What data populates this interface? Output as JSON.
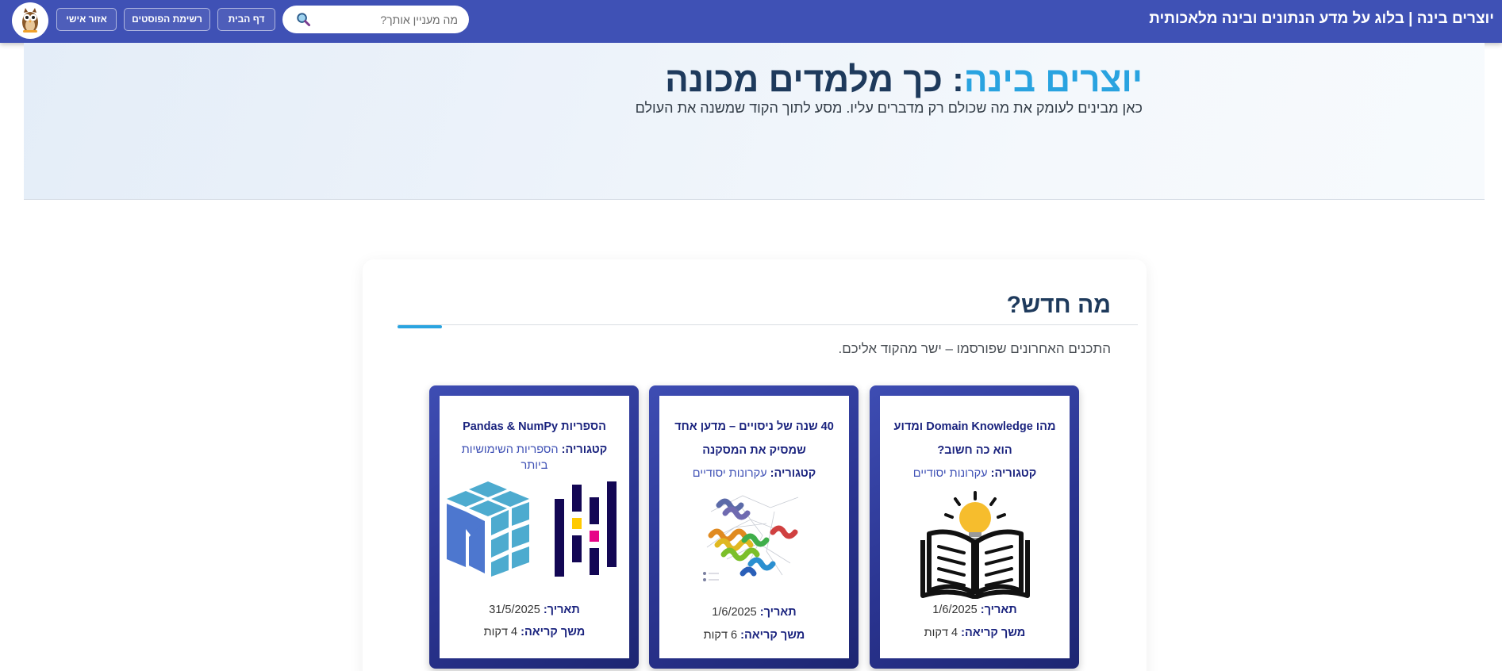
{
  "nav": {
    "site_title": "יוצרים בינה | בלוג על מדע הנתונים ובינה מלאכותית",
    "search_placeholder": "מה מעניין אותך?",
    "buttons": {
      "home": "דף הבית",
      "posts": "רשימת הפוסטים",
      "personal": "אזור אישי"
    },
    "avatar_icon": "owl-avatar-icon"
  },
  "hero": {
    "title_accent": "יוצרים בינה",
    "title_rest": ": כך מלמדים מכונה",
    "subtitle": "כאן מבינים לעומק את מה שכולם רק מדברים עליו. מסע לתוך הקוד שמשנה את העולם"
  },
  "section": {
    "title": "מה חדש?",
    "description": "התכנים האחרונים שפורסמו – ישר מהקוד אליכם."
  },
  "labels": {
    "category": "קטגוריה:",
    "date": "תאריך:",
    "read_time": "משך קריאה:"
  },
  "posts": [
    {
      "title": "מהו Domain Knowledge ומדוע הוא כה חשוב?",
      "category": "עקרונות יסודיים",
      "date": "1/6/2025",
      "read_time": "4 דקות",
      "image": "book-lightbulb-icon"
    },
    {
      "title": "40 שנה של ניסויים – מדען אחד שמסיק את המסקנה",
      "category": "עקרונות יסודיים",
      "date": "1/6/2025",
      "read_time": "6 דקות",
      "image": "protein-structure-image"
    },
    {
      "title": "הספריות Pandas & NumPy",
      "category": "הספריות השימושיות ביותר",
      "date": "31/5/2025",
      "read_time": "4 דקות",
      "image": "pandas-numpy-logos"
    }
  ],
  "colors": {
    "navbar": "#3f51b5",
    "accent": "#29a3e0",
    "title_dark": "#1e3a5c",
    "card_gradient_start": "#3e4db3",
    "card_gradient_end": "#1d2672"
  }
}
